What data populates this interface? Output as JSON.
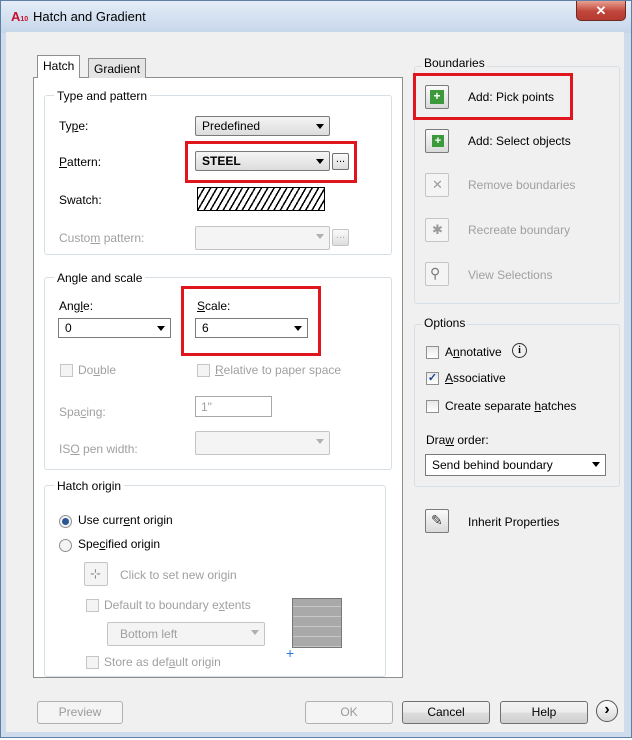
{
  "window": {
    "title": "Hatch and Gradient",
    "app_icon": "autocad-icon",
    "close": "✕"
  },
  "tabs": [
    "Hatch",
    "Gradient"
  ],
  "type_pattern": {
    "group_label": "Type and pattern",
    "type_label": "Type:",
    "type_value": "Predefined",
    "pattern_label": "Pattern:",
    "pattern_value": "STEEL",
    "swatch_label": "Swatch:",
    "custom_label": "Custom pattern:",
    "dots": "..."
  },
  "angle_scale": {
    "group_label": "Angle and scale",
    "angle_label": "Angle:",
    "angle_value": "0",
    "scale_label": "Scale:",
    "scale_value": "6",
    "double_label": "Double",
    "relative_label": "Relative to paper space",
    "spacing_label": "Spacing:",
    "spacing_value": "1\"",
    "iso_label": "ISO pen width:"
  },
  "origin": {
    "group_label": "Hatch origin",
    "use_current": "Use current origin",
    "specified": "Specified origin",
    "click_set": "Click to set new origin",
    "default_extents": "Default to boundary extents",
    "position_value": "Bottom left",
    "store_default": "Store as default origin"
  },
  "boundaries": {
    "group_label": "Boundaries",
    "pick_points": "Add: Pick points",
    "select_objects": "Add: Select objects",
    "remove": "Remove boundaries",
    "recreate": "Recreate boundary",
    "view": "View Selections"
  },
  "options": {
    "group_label": "Options",
    "annotative": "Annotative",
    "associative": "Associative",
    "associative_checked": true,
    "separate": "Create separate hatches",
    "draw_order_label": "Draw order:",
    "draw_order_value": "Send behind boundary"
  },
  "inherit": "Inherit Properties",
  "buttons": {
    "preview": "Preview",
    "ok": "OK",
    "cancel": "Cancel",
    "help": "Help",
    "more": "›"
  },
  "colors": {
    "highlight": "#e0151e",
    "title_bg": "#c6d6ea"
  }
}
